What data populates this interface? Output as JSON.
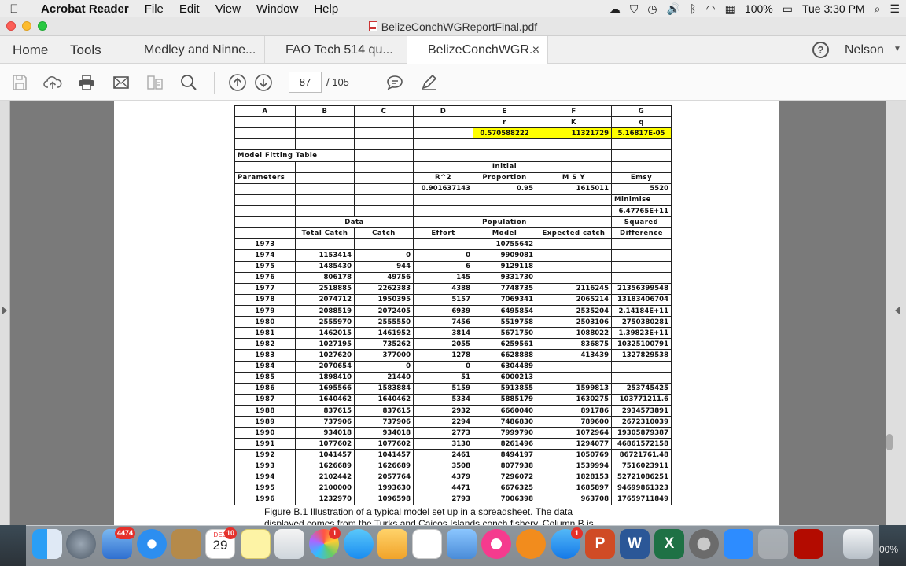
{
  "menubar": {
    "app_name": "Acrobat Reader",
    "items": [
      "File",
      "Edit",
      "View",
      "Window",
      "Help"
    ],
    "battery": "100%",
    "clock": "Tue 3:30 PM"
  },
  "window": {
    "title": "BelizeConchWGReportFinal.pdf"
  },
  "tabs": {
    "home": "Home",
    "tools": "Tools",
    "docs": [
      "Medley and Ninne...",
      "FAO Tech 514  qu...",
      "BelizeConchWGR..."
    ],
    "close_symbol": "×",
    "help_symbol": "?",
    "user": "Nelson"
  },
  "toolbar": {
    "page_current": "87",
    "page_total": "/  105"
  },
  "sheet": {
    "col_letters": [
      "A",
      "B",
      "C",
      "D",
      "E",
      "F",
      "G"
    ],
    "param_names": [
      "r",
      "K",
      "q"
    ],
    "param_values": [
      "0.570588222",
      "11321729",
      "5.16817E-05"
    ],
    "model_fitting_label": "Model Fitting Table",
    "initial_label": "Initial",
    "parameters_label": "Parameters",
    "r2_label": "R^2",
    "proportion_label": "Proportion",
    "msy_label": "M S Y",
    "emsy_label": "Emsy",
    "r2_value": "0.901637143",
    "proportion_value": "0.95",
    "msy_value": "1615011",
    "emsy_value": "5520",
    "minimise_label": "Minimise",
    "minimise_value": "6.47765E+11",
    "data_label": "Data",
    "population_label": "Population",
    "squared_label": "Squared",
    "headers": [
      "Total Catch",
      "Catch",
      "Effort",
      "Model",
      "Expected catch",
      "Difference"
    ],
    "rows": [
      [
        "1973",
        "",
        "",
        "",
        "10755642",
        "",
        ""
      ],
      [
        "1974",
        "1153414",
        "0",
        "0",
        "9909081",
        "",
        ""
      ],
      [
        "1975",
        "1485430",
        "944",
        "6",
        "9129118",
        "",
        ""
      ],
      [
        "1976",
        "806178",
        "49756",
        "145",
        "9331730",
        "",
        ""
      ],
      [
        "1977",
        "2518885",
        "2262383",
        "4388",
        "7748735",
        "2116245",
        "21356399548"
      ],
      [
        "1978",
        "2074712",
        "1950395",
        "5157",
        "7069341",
        "2065214",
        "13183406704"
      ],
      [
        "1979",
        "2088519",
        "2072405",
        "6939",
        "6495854",
        "2535204",
        "2.14184E+11"
      ],
      [
        "1980",
        "2555970",
        "2555550",
        "7456",
        "5519758",
        "2503106",
        "2750380281"
      ],
      [
        "1981",
        "1462015",
        "1461952",
        "3814",
        "5671750",
        "1088022",
        "1.39823E+11"
      ],
      [
        "1982",
        "1027195",
        "735262",
        "2055",
        "6259561",
        "836875",
        "10325100791"
      ],
      [
        "1983",
        "1027620",
        "377000",
        "1278",
        "6628888",
        "413439",
        "1327829538"
      ],
      [
        "1984",
        "2070654",
        "0",
        "0",
        "6304489",
        "",
        ""
      ],
      [
        "1985",
        "1898410",
        "21440",
        "51",
        "6000213",
        "",
        ""
      ],
      [
        "1986",
        "1695566",
        "1583884",
        "5159",
        "5913855",
        "1599813",
        "253745425"
      ],
      [
        "1987",
        "1640462",
        "1640462",
        "5334",
        "5885179",
        "1630275",
        "103771211.6"
      ],
      [
        "1988",
        "837615",
        "837615",
        "2932",
        "6660040",
        "891786",
        "2934573891"
      ],
      [
        "1989",
        "737906",
        "737906",
        "2294",
        "7486830",
        "789600",
        "2672310039"
      ],
      [
        "1990",
        "934018",
        "934018",
        "2773",
        "7999790",
        "1072964",
        "19305879387"
      ],
      [
        "1991",
        "1077602",
        "1077602",
        "3130",
        "8261496",
        "1294077",
        "46861572158"
      ],
      [
        "1992",
        "1041457",
        "1041457",
        "2461",
        "8494197",
        "1050769",
        "86721761.48"
      ],
      [
        "1993",
        "1626689",
        "1626689",
        "3508",
        "8077938",
        "1539994",
        "7516023911"
      ],
      [
        "1994",
        "2102442",
        "2057764",
        "4379",
        "7296072",
        "1828153",
        "52721086251"
      ],
      [
        "1995",
        "2100000",
        "1993630",
        "4471",
        "6676325",
        "1685897",
        "94699861323"
      ],
      [
        "1996",
        "1232970",
        "1096598",
        "2793",
        "7006398",
        "963708",
        "17659711849"
      ]
    ]
  },
  "caption": "Figure B.1 Illustration of a typical model set up in a spreadsheet. The data displayed comes from the Turks and Caicos Islands conch fishery. Column B is",
  "dock": {
    "mail_badge": "4474",
    "calendar_month": "DEC",
    "calendar_day": "29",
    "calendar_badge": "10",
    "photos_badge": "1",
    "appstore_badge": "1",
    "zoom_readout": "00%"
  }
}
